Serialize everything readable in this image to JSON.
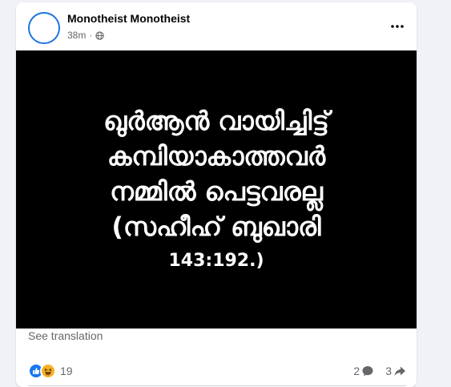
{
  "post": {
    "author_name": "Monotheist Monotheist",
    "time": "38m",
    "meta_separator": "·",
    "privacy_icon": "globe-icon",
    "more_icon": "more-options-icon",
    "image": {
      "lines": [
        "ഖുർആൻ വായിച്ചിട്ട്",
        "കമ്പിയാകാത്തവർ",
        "നമ്മിൽ പെട്ടവരല്ല",
        "(സഹീഹ് ബുഖാരി",
        "143:192.)"
      ]
    },
    "see_translation": "See translation",
    "reactions": {
      "icons": [
        "like-icon",
        "haha-icon"
      ],
      "count": "19"
    },
    "comments_count": "2",
    "shares_count": "3",
    "colors": {
      "accent": "#1877f2",
      "haha": "#f7b125",
      "muted_text": "#65676b",
      "image_background": "#000000"
    }
  }
}
